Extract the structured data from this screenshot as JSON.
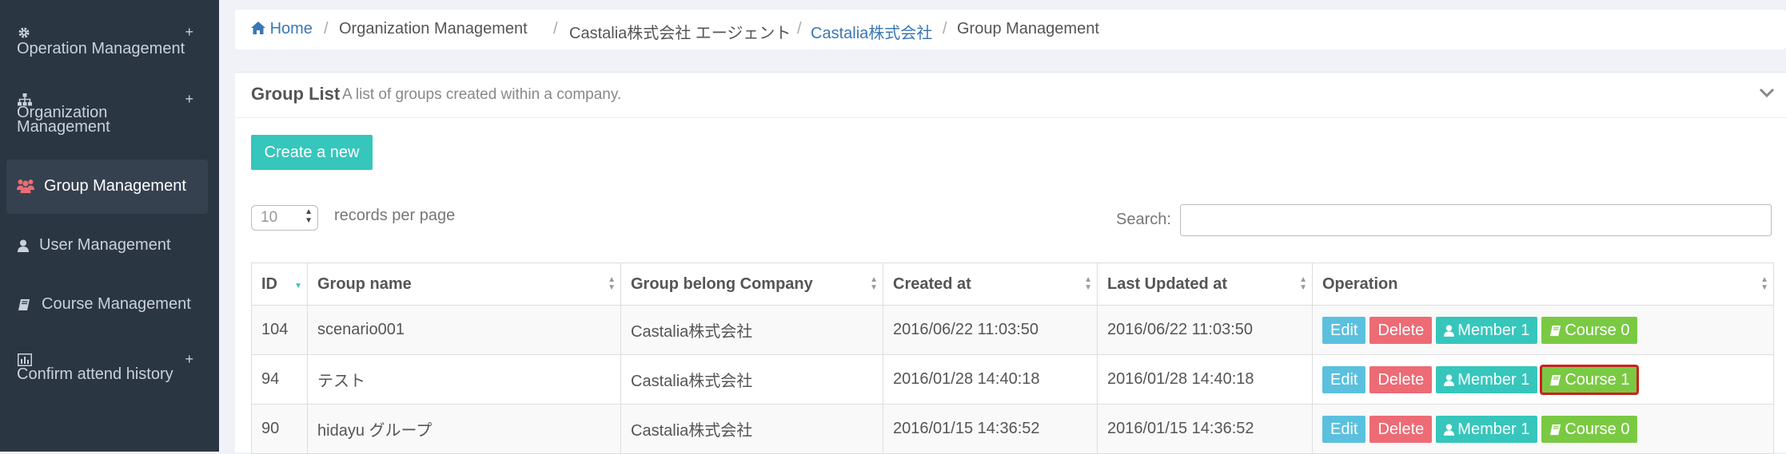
{
  "sidebar": {
    "items": [
      {
        "label": "Operation Management",
        "icon": "gear-icon",
        "expand": "+"
      },
      {
        "label": "Organization Management",
        "icon": "sitemap-icon",
        "expand": "+"
      },
      {
        "label": "Group Management",
        "icon": "users-icon",
        "active": true
      },
      {
        "label": "User Management",
        "icon": "user-icon"
      },
      {
        "label": "Course Management",
        "icon": "book-icon"
      },
      {
        "label": "Confirm attend history",
        "icon": "bar-chart-icon",
        "expand": "+"
      }
    ]
  },
  "breadcrumb": {
    "home": "Home",
    "sep": "/",
    "items": [
      "Organization Management",
      "Castalia株式会社 エージェント",
      "Castalia株式会社",
      "Group Management"
    ]
  },
  "panel": {
    "title": "Group List",
    "subtitle": "A list of groups created within a company.",
    "create_label": "Create a new",
    "length": {
      "value": "10",
      "label": "records per page"
    },
    "search": {
      "label": "Search:",
      "value": ""
    }
  },
  "table": {
    "columns": [
      "ID",
      "Group name",
      "Group belong Company",
      "Created at",
      "Last Updated at",
      "Operation"
    ],
    "rows": [
      {
        "id": "104",
        "name": "scenario001",
        "company": "Castalia株式会社",
        "created": "2016/06/22 11:03:50",
        "updated": "2016/06/22 11:03:50",
        "edit": "Edit",
        "delete": "Delete",
        "member": "Member 1",
        "course": "Course 0"
      },
      {
        "id": "94",
        "name": "テスト",
        "company": "Castalia株式会社",
        "created": "2016/01/28 14:40:18",
        "updated": "2016/01/28 14:40:18",
        "edit": "Edit",
        "delete": "Delete",
        "member": "Member 1",
        "course": "Course 1",
        "highlighted": true
      },
      {
        "id": "90",
        "name": "hidayu グループ",
        "company": "Castalia株式会社",
        "created": "2016/01/15 14:36:52",
        "updated": "2016/01/15 14:36:52",
        "edit": "Edit",
        "delete": "Delete",
        "member": "Member 1",
        "course": "Course 0"
      }
    ]
  },
  "colors": {
    "sidebar_bg": "#2b3643",
    "active_icon": "#ed6b75",
    "teal": "#36c6bc",
    "edit": "#5bc0de",
    "delete": "#ed6b75",
    "course": "#7ac943",
    "highlight": "#cc1f1f",
    "link": "#3b77b5"
  }
}
